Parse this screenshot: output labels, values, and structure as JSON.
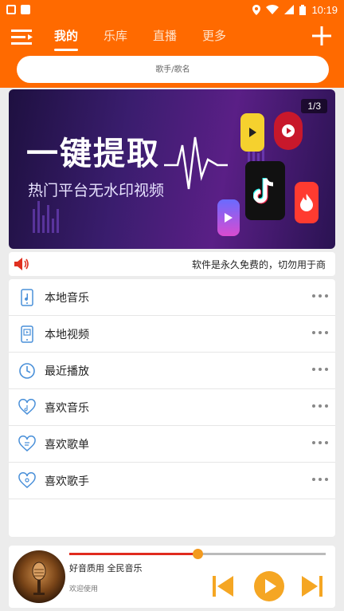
{
  "status_bar": {
    "time": "10:19"
  },
  "header": {
    "tabs": [
      {
        "label": "我的",
        "active": true
      },
      {
        "label": "乐库",
        "active": false
      },
      {
        "label": "直播",
        "active": false
      },
      {
        "label": "更多",
        "active": false
      }
    ],
    "accent_color": "#ff6a00"
  },
  "search": {
    "placeholder": "歌手/歌名"
  },
  "banner": {
    "title": "一键提取",
    "subtitle": "热门平台无水印视频",
    "counter": "1/3"
  },
  "notice": {
    "text": "软件是永久免费的，切勿用于商"
  },
  "menu": {
    "items": [
      {
        "label": "本地音乐",
        "icon": "local-music-icon"
      },
      {
        "label": "本地视频",
        "icon": "local-video-icon"
      },
      {
        "label": "最近播放",
        "icon": "clock-icon"
      },
      {
        "label": "喜欢音乐",
        "icon": "heart-icon"
      },
      {
        "label": "喜欢歌单",
        "icon": "heart-icon"
      },
      {
        "label": "喜欢歌手",
        "icon": "heart-icon"
      }
    ]
  },
  "player": {
    "song_title": "好音质用 全民音乐",
    "song_subtitle": "欢迎使用",
    "progress": 0.5,
    "progress_color": "#e02b1e",
    "control_color": "#f5a623"
  }
}
